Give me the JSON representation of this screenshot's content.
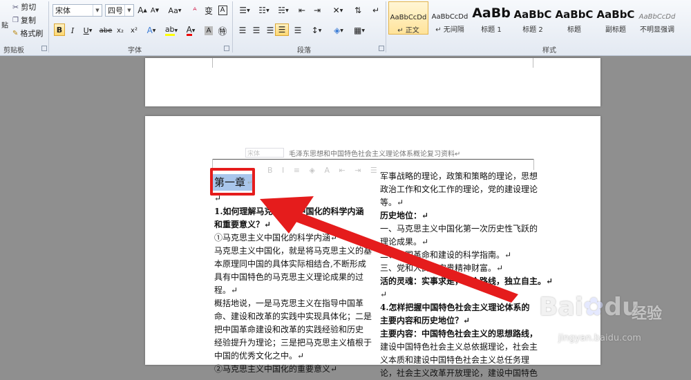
{
  "clipboard": {
    "cut": "剪切",
    "copy": "复制",
    "format_painter": "格式刷",
    "paste_fragment": "贴",
    "label": "剪贴板"
  },
  "font": {
    "name": "宋体",
    "size": "四号",
    "label": "字体",
    "grow": "A",
    "shrink": "A",
    "case": "Aa",
    "wen": "变",
    "bold": "B",
    "italic": "I",
    "underline": "U",
    "strike": "abe",
    "sub": "x₂",
    "sup": "x²"
  },
  "paragraph": {
    "label": "段落"
  },
  "styles": {
    "label": "样式",
    "items": [
      {
        "preview": "AaBbCcDd",
        "name": "↵ 正文"
      },
      {
        "preview": "AaBbCcDd",
        "name": "↵ 无间隔"
      },
      {
        "preview": "AaBb",
        "name": "标题 1"
      },
      {
        "preview": "AaBbC",
        "name": "标题 2"
      },
      {
        "preview": "AaBbC",
        "name": "标题"
      },
      {
        "preview": "AaBbC",
        "name": "副标题"
      },
      {
        "preview": "AaBbCcDd",
        "name": "不明显强调"
      }
    ]
  },
  "document": {
    "header": "毛泽东思想和中国特色社会主义理论体系概论复习资料↵",
    "mini_font": "宋体",
    "chapter": "第一章",
    "left_col": [
      {
        "t": "↵",
        "b": false
      },
      {
        "t": "1.如何理解马克思主义中国化的科学内涵",
        "b": true
      },
      {
        "t": "和重要意义？↵",
        "b": true
      },
      {
        "t": "①马克思主义中国化的科学内涵↵",
        "b": false
      },
      {
        "t": "马克思主义中国化，就是将马克思主义的基",
        "b": false
      },
      {
        "t": "本原理同中国的具体实际相结合,不断形成",
        "b": false
      },
      {
        "t": "具有中国特色的马克思主义理论成果的过",
        "b": false
      },
      {
        "t": "程。↵",
        "b": false
      },
      {
        "t": "概括地说，一是马克思主义在指导中国革",
        "b": false
      },
      {
        "t": "命、建设和改革的实践中实现具体化；二是",
        "b": false
      },
      {
        "t": "把中国革命建设和改革的实践经验和历史",
        "b": false
      },
      {
        "t": "经验提升为理论；三是把马克思主义植根于",
        "b": false
      },
      {
        "t": "中国的优秀文化之中。↵",
        "b": false
      },
      {
        "t": "②马克思主义中国化的重要意义↵",
        "b": false
      }
    ],
    "right_col": [
      {
        "t": "军事战略的理论，政策和策略的理论，思想",
        "b": false
      },
      {
        "t": "政治工作和文化工作的理论，党的建设理论",
        "b": false
      },
      {
        "t": "等。↵",
        "b": false
      },
      {
        "t": "历史地位：↵",
        "b": true
      },
      {
        "t": "一、马克思主义中国化第一次历史性飞跃的",
        "b": false
      },
      {
        "t": "理论成果。↵",
        "b": false
      },
      {
        "t": "二、中国革命和建设的科学指南。↵",
        "b": false
      },
      {
        "t": "三、党和人民的宝贵精神财富。↵",
        "b": false
      },
      {
        "t": "活的灵魂：实事求是，群众路线，独立自主。↵",
        "b": true
      },
      {
        "t": "↵",
        "b": false
      },
      {
        "t": "4.怎样把握中国特色社会主义理论体系的",
        "b": true
      },
      {
        "t": "主要内容和历史地位？↵",
        "b": true
      },
      {
        "t": "主要内容：中国特色社会主义的思想路线，",
        "b": true
      },
      {
        "t": "建设中国特色社会主义总依据理论，社会主",
        "b": false
      },
      {
        "t": "义本质和建设中国特色社会主义总任务理",
        "b": false
      },
      {
        "t": "论，社会主义改革开放理论，建设中国特色",
        "b": false
      }
    ]
  },
  "watermark": {
    "brand": "Bai",
    "brand2": "du",
    "jingyan": "经验",
    "url": "jingyan.baidu.com"
  },
  "colors": {
    "highlight_box": "#e51c1c",
    "arrow": "#e51c1c",
    "selection": "#a9c6ec"
  }
}
